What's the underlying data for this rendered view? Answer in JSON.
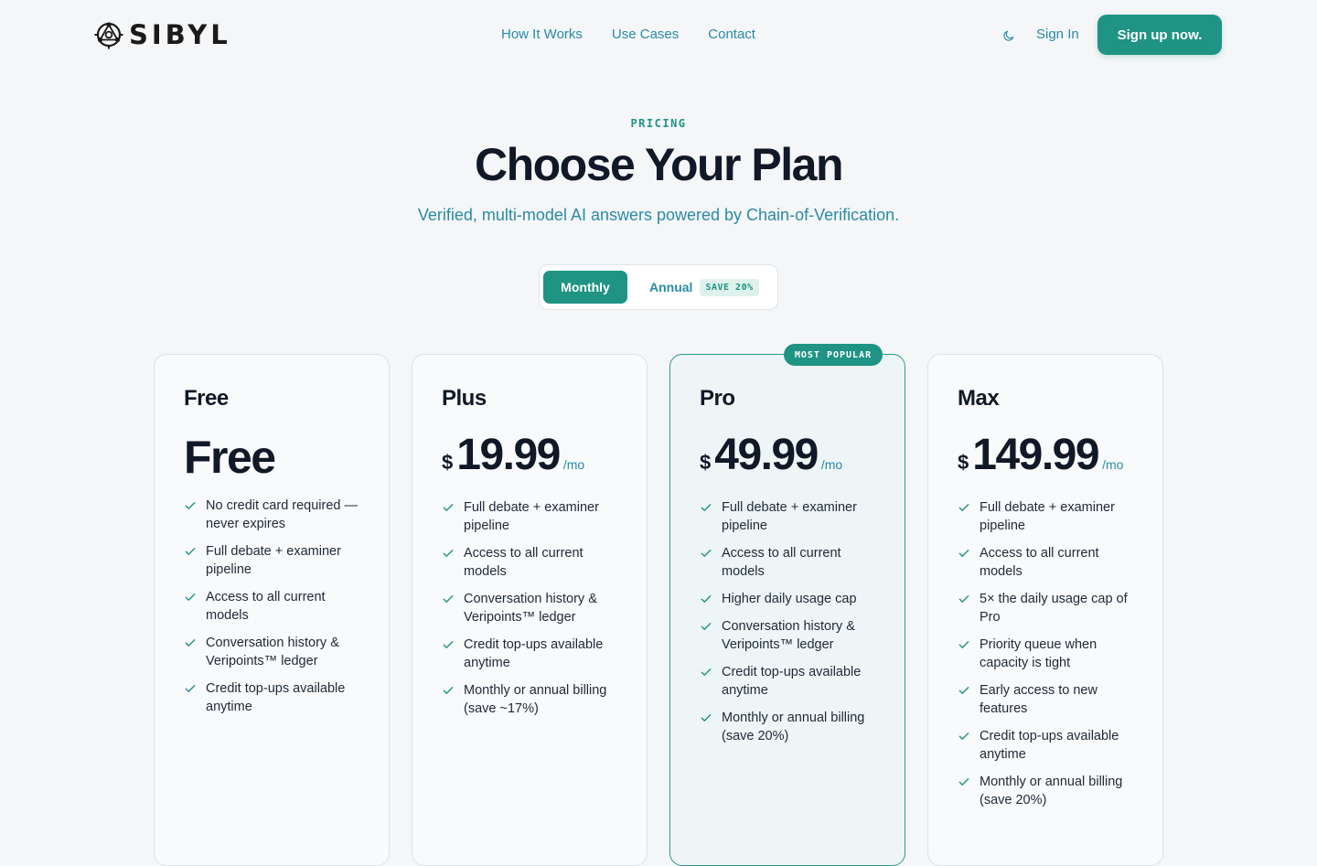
{
  "header": {
    "logo_text": "SIBYL",
    "nav": [
      "How It Works",
      "Use Cases",
      "Contact"
    ],
    "theme_icon": "moon-icon",
    "signin_label": "Sign In",
    "signup_label": "Sign up now."
  },
  "hero": {
    "eyebrow": "PRICING",
    "title": "Choose Your Plan",
    "subtitle": "Verified, multi-model AI answers powered by Chain-of-Verification."
  },
  "billing_toggle": {
    "monthly_label": "Monthly",
    "annual_label": "Annual",
    "save_badge": "SAVE 20%",
    "selected": "Monthly"
  },
  "colors": {
    "accent": "#1f9384",
    "link": "#2a8aa6",
    "text": "#111827"
  },
  "plans": [
    {
      "name": "Free",
      "currency": "",
      "price": "Free",
      "period": "",
      "features": [
        "No credit card required — never expires",
        "Full debate + examiner pipeline",
        "Access to all current models",
        "Conversation history & Veripoints™ ledger",
        "Credit top-ups available anytime"
      ]
    },
    {
      "name": "Plus",
      "currency": "$",
      "price": "19.99",
      "period": "/mo",
      "features": [
        "Full debate + examiner pipeline",
        "Access to all current models",
        "Conversation history & Veripoints™ ledger",
        "Credit top-ups available anytime",
        "Monthly or annual billing (save ~17%)"
      ]
    },
    {
      "name": "Pro",
      "badge": "MOST POPULAR",
      "currency": "$",
      "price": "49.99",
      "period": "/mo",
      "features": [
        "Full debate + examiner pipeline",
        "Access to all current models",
        "Higher daily usage cap",
        "Conversation history & Veripoints™ ledger",
        "Credit top-ups available anytime",
        "Monthly or annual billing (save 20%)"
      ]
    },
    {
      "name": "Max",
      "currency": "$",
      "price": "149.99",
      "period": "/mo",
      "features": [
        "Full debate + examiner pipeline",
        "Access to all current models",
        "5× the daily usage cap of Pro",
        "Priority queue when capacity is tight",
        "Early access to new features",
        "Credit top-ups available anytime",
        "Monthly or annual billing (save 20%)"
      ]
    }
  ]
}
